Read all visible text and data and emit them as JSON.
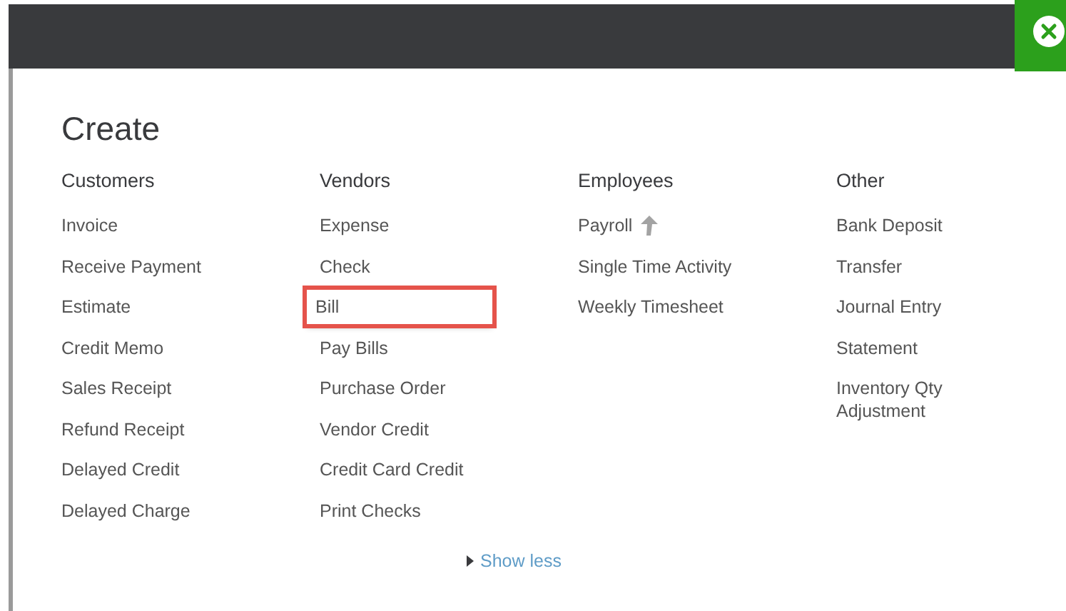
{
  "title": "Create",
  "columns": [
    {
      "heading": "Customers",
      "items": [
        {
          "label": "Invoice",
          "kind": "plain",
          "highlighted": false
        },
        {
          "label": "Receive Payment",
          "kind": "plain",
          "highlighted": false
        },
        {
          "label": "Estimate",
          "kind": "plain",
          "highlighted": false
        },
        {
          "label": "Credit Memo",
          "kind": "plain",
          "highlighted": false
        },
        {
          "label": "Sales Receipt",
          "kind": "plain",
          "highlighted": false
        },
        {
          "label": "Refund Receipt",
          "kind": "plain",
          "highlighted": false
        },
        {
          "label": "Delayed Credit",
          "kind": "plain",
          "highlighted": false
        },
        {
          "label": "Delayed Charge",
          "kind": "plain",
          "highlighted": false
        }
      ]
    },
    {
      "heading": "Vendors",
      "items": [
        {
          "label": "Expense",
          "kind": "plain",
          "highlighted": false
        },
        {
          "label": "Check",
          "kind": "plain",
          "highlighted": false
        },
        {
          "label": "Bill",
          "kind": "plain",
          "highlighted": true
        },
        {
          "label": "Pay Bills",
          "kind": "plain",
          "highlighted": false
        },
        {
          "label": "Purchase Order",
          "kind": "plain",
          "highlighted": false
        },
        {
          "label": "Vendor Credit",
          "kind": "plain",
          "highlighted": false
        },
        {
          "label": "Credit Card Credit",
          "kind": "plain",
          "highlighted": false
        },
        {
          "label": "Print Checks",
          "kind": "plain",
          "highlighted": false
        }
      ]
    },
    {
      "heading": "Employees",
      "items": [
        {
          "label": "Payroll",
          "kind": "upgrade",
          "highlighted": false
        },
        {
          "label": "Single Time Activity",
          "kind": "plain",
          "highlighted": false
        },
        {
          "label": "Weekly Timesheet",
          "kind": "plain",
          "highlighted": false
        }
      ]
    },
    {
      "heading": "Other",
      "items": [
        {
          "label": "Bank Deposit",
          "kind": "plain",
          "highlighted": false
        },
        {
          "label": "Transfer",
          "kind": "plain",
          "highlighted": false
        },
        {
          "label": "Journal Entry",
          "kind": "plain",
          "highlighted": false
        },
        {
          "label": "Statement",
          "kind": "plain",
          "highlighted": false
        },
        {
          "label": "Inventory Qty Adjustment",
          "kind": "plain",
          "highlighted": false
        }
      ]
    }
  ],
  "toggle": {
    "label": "Show less"
  }
}
